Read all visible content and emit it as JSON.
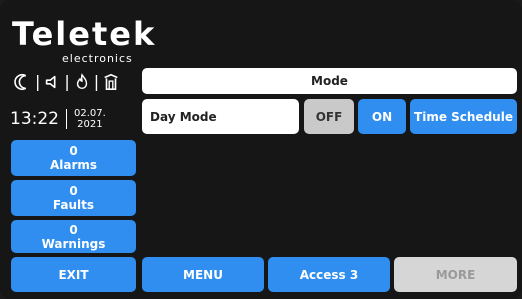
{
  "brand": {
    "logo": "Teletek",
    "subtitle": "electronics"
  },
  "status_icons": [
    "moon-icon",
    "speaker-icon",
    "fire-icon",
    "door-icon"
  ],
  "clock": {
    "time": "13:22",
    "date_line1": "02.07.",
    "date_line2": "2021"
  },
  "sidebar": {
    "alarms": {
      "count": "0",
      "label": "Alarms"
    },
    "faults": {
      "count": "0",
      "label": "Faults"
    },
    "warnings": {
      "count": "0",
      "label": "Warnings"
    }
  },
  "main": {
    "header": "Mode",
    "mode_value": "Day Mode",
    "off_label": "OFF",
    "on_label": "ON",
    "schedule_label": "Time Schedule"
  },
  "footer": {
    "exit_label": "EXIT",
    "menu_label": "MENU",
    "access_label": "Access 3",
    "more_label": "MORE"
  },
  "colors": {
    "accent": "#2f8ef0",
    "background": "#161616",
    "off_button": "#c9c9c9"
  }
}
